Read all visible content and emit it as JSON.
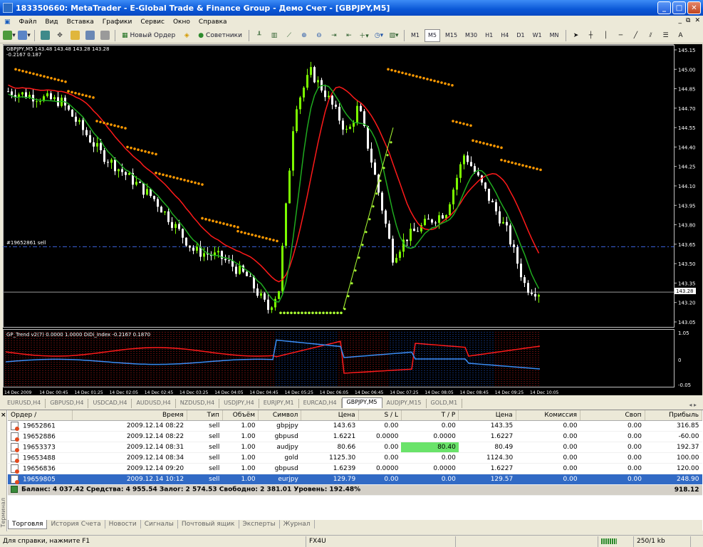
{
  "window": {
    "title": "183350660: MetaTrader - E-Global Trade & Finance Group - Демо Счет - [GBPJPY,M5]"
  },
  "menu": [
    "Файл",
    "Вид",
    "Вставка",
    "Графики",
    "Сервис",
    "Окно",
    "Справка"
  ],
  "toolbar": {
    "new_order": "Новый Ордер",
    "advisors": "Советники",
    "timeframes": [
      "M1",
      "M5",
      "M15",
      "M30",
      "H1",
      "H4",
      "D1",
      "W1",
      "MN"
    ],
    "active_timeframe": "M5"
  },
  "chart": {
    "header_line1": "GBPJPY,M5  143.48 143.48 143.28 143.28",
    "header_line2": "-0.2167  0.187",
    "order_line_label": "#19652861 sell",
    "current_price": "143.28",
    "price_ticks": [
      "145.15",
      "145.00",
      "144.85",
      "144.70",
      "144.55",
      "144.40",
      "144.25",
      "144.10",
      "143.95",
      "143.80",
      "143.65",
      "143.50",
      "143.35",
      "143.28",
      "143.20",
      "143.05"
    ],
    "indicator_label": "GP_Trend v2(7) 0.0000 1.0000  DiDi_Index -0.2167 0.1870",
    "indicator_ticks": [
      "1.05",
      "0",
      "-0.05"
    ],
    "time_ticks": [
      "14 Dec 2009",
      "14 Dec 00:45",
      "14 Dec 01:25",
      "14 Dec 02:05",
      "14 Dec 02:45",
      "14 Dec 03:25",
      "14 Dec 04:05",
      "14 Dec 04:45",
      "14 Dec 05:25",
      "14 Dec 06:05",
      "14 Dec 06:45",
      "14 Dec 07:25",
      "14 Dec 08:05",
      "14 Dec 08:45",
      "14 Dec 09:25",
      "14 Dec 10:05"
    ],
    "colors": {
      "bull": "#7cfc00",
      "bear": "#ffffff",
      "red_ma": "#ff1a1a",
      "green_ma": "#1faa1f",
      "dots_orange": "#ff9a00",
      "dots_green": "#aaff33",
      "order_line": "#3a5fd6",
      "blue_line": "#3a8df5"
    }
  },
  "chart_tabs": [
    "EURUSD,H4",
    "GBPUSD,H4",
    "USDCAD,H4",
    "AUDUSD,H4",
    "NZDUSD,H4",
    "USDJPY,H4",
    "EURJPY,M1",
    "EURCAD,H4",
    "GBPJPY,M5",
    "AUDJPY,M15",
    "GOLD,M1"
  ],
  "active_chart_tab": "GBPJPY,M5",
  "orders": {
    "headers": [
      "Ордер",
      "Время",
      "Тип",
      "Объём",
      "Символ",
      "Цена",
      "S / L",
      "T / P",
      "Цена",
      "Комиссия",
      "Своп",
      "Прибыль"
    ],
    "rows": [
      {
        "id": "19652861",
        "time": "2009.12.14 08:22",
        "type": "sell",
        "vol": "1.00",
        "sym": "gbpjpy",
        "price": "143.63",
        "sl": "0.00",
        "tp": "0.00",
        "cur": "143.35",
        "comm": "0.00",
        "swap": "0.00",
        "profit": "316.85"
      },
      {
        "id": "19652886",
        "time": "2009.12.14 08:22",
        "type": "sell",
        "vol": "1.00",
        "sym": "gbpusd",
        "price": "1.6221",
        "sl": "0.0000",
        "tp": "0.0000",
        "cur": "1.6227",
        "comm": "0.00",
        "swap": "0.00",
        "profit": "-60.00"
      },
      {
        "id": "19653373",
        "time": "2009.12.14 08:31",
        "type": "sell",
        "vol": "1.00",
        "sym": "audjpy",
        "price": "80.66",
        "sl": "0.00",
        "tp": "80.40",
        "cur": "80.49",
        "comm": "0.00",
        "swap": "0.00",
        "profit": "192.37"
      },
      {
        "id": "19653488",
        "time": "2009.12.14 08:34",
        "type": "sell",
        "vol": "1.00",
        "sym": "gold",
        "price": "1125.30",
        "sl": "0.00",
        "tp": "0.00",
        "cur": "1124.30",
        "comm": "0.00",
        "swap": "0.00",
        "profit": "100.00"
      },
      {
        "id": "19656836",
        "time": "2009.12.14 09:20",
        "type": "sell",
        "vol": "1.00",
        "sym": "gbpusd",
        "price": "1.6239",
        "sl": "0.0000",
        "tp": "0.0000",
        "cur": "1.6227",
        "comm": "0.00",
        "swap": "0.00",
        "profit": "120.00"
      },
      {
        "id": "19659805",
        "time": "2009.12.14 10:12",
        "type": "sell",
        "vol": "1.00",
        "sym": "eurjpy",
        "price": "129.79",
        "sl": "0.00",
        "tp": "0.00",
        "cur": "129.57",
        "comm": "0.00",
        "swap": "0.00",
        "profit": "248.90"
      }
    ],
    "balance_text": "Баланс: 4 037.42  Средства: 4 955.54  Залог: 2 574.53  Свободно: 2 381.01  Уровень: 192.48%",
    "total_profit": "918.12"
  },
  "terminal_tabs": [
    "Торговля",
    "История Счета",
    "Новости",
    "Сигналы",
    "Почтовый ящик",
    "Эксперты",
    "Журнал"
  ],
  "terminal_side_label": "Терминал",
  "status": {
    "help": "Для справки, нажмите F1",
    "profile": "FX4U",
    "traffic": "250/1 kb"
  }
}
